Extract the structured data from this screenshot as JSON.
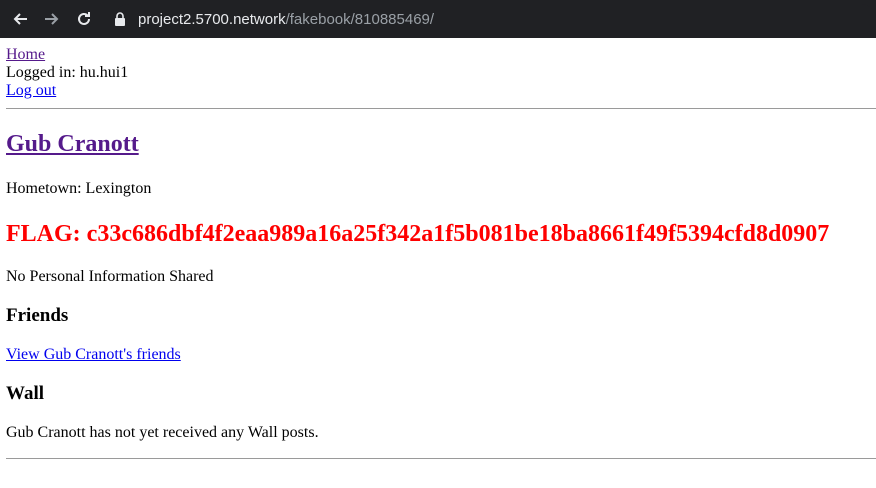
{
  "browser": {
    "url_host": "project2.5700.network",
    "url_path": "/fakebook/810885469/"
  },
  "nav": {
    "home_label": "Home",
    "logged_in_text": "Logged in: hu.hui1",
    "logout_label": "Log out"
  },
  "profile": {
    "name": "Gub Cranott",
    "hometown": "Hometown: Lexington",
    "flag": "FLAG: c33c686dbf4f2eaa989a16a25f342a1f5b081be18ba8661f49f5394cfd8d0907",
    "personal_info": "No Personal Information Shared"
  },
  "friends": {
    "heading": "Friends",
    "link_label": "View Gub Cranott's friends"
  },
  "wall": {
    "heading": "Wall",
    "empty_text": "Gub Cranott has not yet received any Wall posts."
  },
  "colors": {
    "flag": "#ff0000",
    "link": "#0000ee",
    "visited_link": "#551a8b",
    "toolbar_bg": "#202124"
  }
}
